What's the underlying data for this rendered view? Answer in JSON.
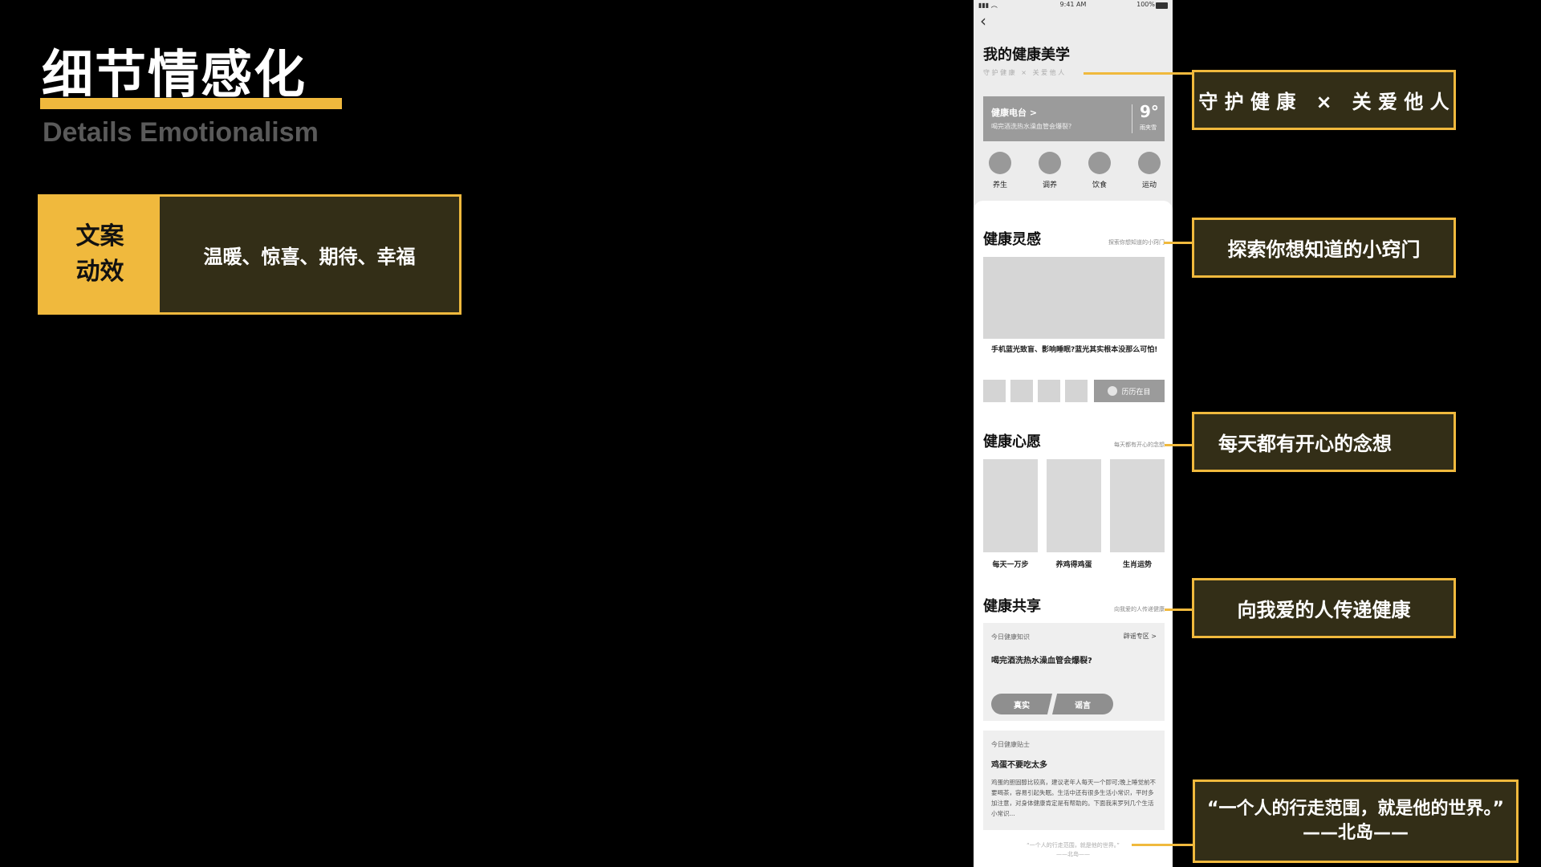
{
  "slide": {
    "title": "细节情感化",
    "subtitle": "Details Emotionalism",
    "card_tag_line1": "文案",
    "card_tag_line2": "动效",
    "card_desc": "温暖、惊喜、期待、幸福"
  },
  "phone": {
    "status_time": "9:41 AM",
    "status_battery": "100%",
    "page_title": "我的健康美学",
    "page_tagline": "守 护 健 康   ×   关 爱 他 人",
    "radio": {
      "title": "健康电台 >",
      "subtitle": "喝完酒洗热水澡血管会爆裂?",
      "temp": "9°",
      "weather": "雨夹雪"
    },
    "categories": [
      "养生",
      "调养",
      "饮食",
      "运动"
    ],
    "inspiration": {
      "title": "健康灵感",
      "hint": "探索你想知道的小窍门",
      "article": "手机蓝光致盲、影响睡眠?蓝光其实根本没那么可怕!",
      "button": "历历在目"
    },
    "wishes": {
      "title": "健康心愿",
      "hint": "每天都有开心的念想",
      "items": [
        "每天一万步",
        "养鸡得鸡蛋",
        "生肖运势"
      ]
    },
    "share": {
      "title": "健康共享",
      "hint": "向我爱的人传递健康",
      "knowledge_label": "今日健康知识",
      "knowledge_link": "辟谣专区 >",
      "knowledge_question": "喝完酒洗热水澡血管会爆裂?",
      "btn_true": "真实",
      "btn_rumor": "谣言",
      "tip_label": "今日健康贴士",
      "tip_title": "鸡蛋不要吃太多",
      "tip_body": "鸡蛋的胆固醇比较高，建议老年人每天一个即可;晚上睡觉前不要喝茶，容易引起失眠。生活中还有很多生活小常识，平时多加注意，对身体健康肯定是有帮助的。下面我来罗列几个生活小常识...",
      "footer_quote": "“一个人的行走范围，就是他的世界。”",
      "footer_author": "——北岛——"
    }
  },
  "annotations": {
    "tagline": "守 护 健 康   ×   关 爱 他 人",
    "inspiration": "探索你想知道的小窍门",
    "wishes": "每天都有开心的念想",
    "share": "向我爱的人传递健康",
    "quote_line1": "“一个人的行走范围，就是他的世界。”",
    "quote_line2": "——北岛——"
  },
  "colors": {
    "accent": "#f0b93d",
    "card_bg": "#332e17",
    "phone_bg": "#ececec"
  }
}
